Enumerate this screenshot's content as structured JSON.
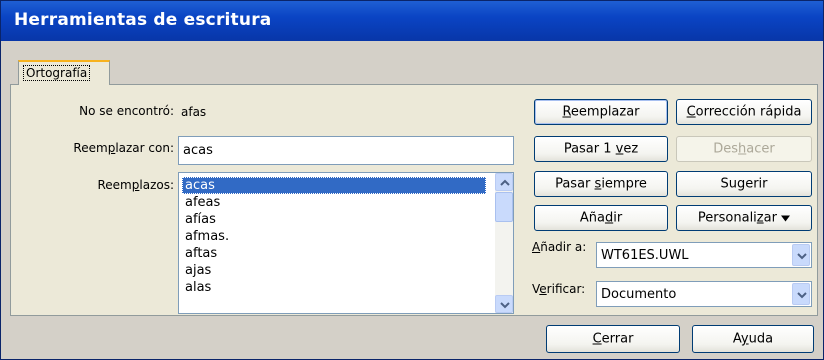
{
  "window": {
    "title": "Herramientas de escritura"
  },
  "tabs": [
    {
      "label": "Ortografía"
    }
  ],
  "not_found": {
    "label": "No se encontró:",
    "value": "afas"
  },
  "replace_with": {
    "label_pre": "Reem",
    "label_u": "p",
    "label_post": "lazar con:",
    "value": "acas"
  },
  "replacements": {
    "label_pre": "Reem",
    "label_u": "p",
    "label_post": "lazos:",
    "items": [
      "acas",
      "afeas",
      "afías",
      "afmas.",
      "aftas",
      "ajas",
      "alas"
    ],
    "selected_index": 0
  },
  "buttons": {
    "replace": {
      "u": "R",
      "rest": "eemplazar"
    },
    "quick_fix": {
      "u": "C",
      "rest": "orrección rápida"
    },
    "skip_once_pre": "Pasar 1 ",
    "skip_once_u": "v",
    "skip_once_post": "ez",
    "undo_pre": "Des",
    "undo_u": "h",
    "undo_post": "acer",
    "skip_always_pre": "Pasar ",
    "skip_always_u": "s",
    "skip_always_post": "iempre",
    "suggest": "Sugerir",
    "add_pre": "Aña",
    "add_u": "d",
    "add_post": "ir",
    "customize_pre": "Personali",
    "customize_u": "z",
    "customize_post": "ar",
    "close_u": "C",
    "close_rest": "errar",
    "help_pre": "A",
    "help_u": "y",
    "help_post": "uda"
  },
  "add_to": {
    "label_u": "A",
    "label_rest": "ñadir a:",
    "value": "WT61ES.UWL"
  },
  "verify": {
    "label_pre": "V",
    "label_u": "e",
    "label_post": "rificar:",
    "value": "Documento"
  }
}
